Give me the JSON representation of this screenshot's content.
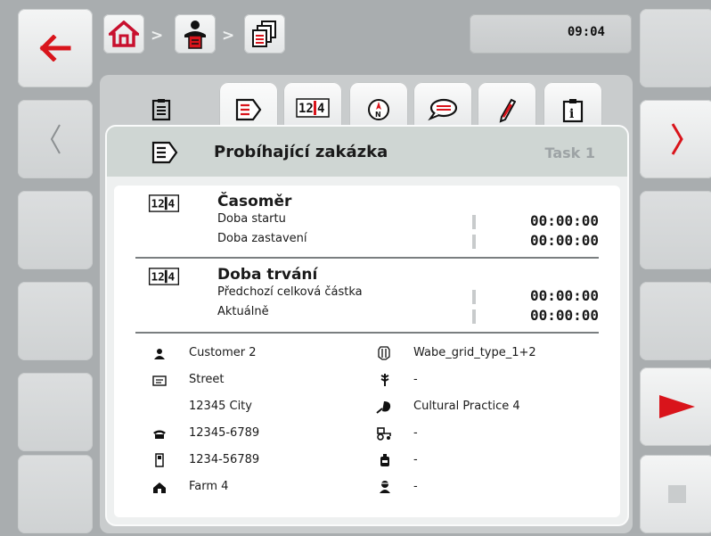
{
  "header": {
    "clock": "09:04"
  },
  "tabs": [
    {
      "name": "tab-overview-icon"
    },
    {
      "name": "tab-current-task-icon"
    },
    {
      "name": "tab-counters-icon"
    },
    {
      "name": "tab-navigation-icon"
    },
    {
      "name": "tab-notes-icon"
    },
    {
      "name": "tab-edit-icon"
    },
    {
      "name": "tab-info-icon"
    }
  ],
  "panel": {
    "title": "Probíhající zakázka",
    "task": "Task 1"
  },
  "timer": {
    "title": "Časoměr",
    "rows": [
      {
        "label": "Doba startu",
        "value": "00:00:00"
      },
      {
        "label": "Doba zastavení",
        "value": "00:00:00"
      }
    ]
  },
  "duration": {
    "title": "Doba trvání",
    "rows": [
      {
        "label": "Předchozí celková částka",
        "value": "00:00:00"
      },
      {
        "label": "Aktuálně",
        "value": "00:00:00"
      }
    ]
  },
  "details": {
    "left": [
      {
        "icon": "customer-icon",
        "text": "Customer 2"
      },
      {
        "icon": "address-icon",
        "text": "Street"
      },
      {
        "icon": "",
        "text": "12345 City"
      },
      {
        "icon": "phone-icon",
        "text": "12345-6789"
      },
      {
        "icon": "mobile-icon",
        "text": "1234-56789"
      },
      {
        "icon": "farm-icon",
        "text": "Farm 4"
      }
    ],
    "right": [
      {
        "icon": "field-icon",
        "text": "Wabe_grid_type_1+2"
      },
      {
        "icon": "crop-icon",
        "text": "-"
      },
      {
        "icon": "cultural-practice-icon",
        "text": "Cultural Practice 4"
      },
      {
        "icon": "machine-icon",
        "text": "-"
      },
      {
        "icon": "product-icon",
        "text": "-"
      },
      {
        "icon": "driver-icon",
        "text": "-"
      }
    ]
  },
  "colors": {
    "accent_red": "#d9141b",
    "home_red": "#c8102e"
  }
}
